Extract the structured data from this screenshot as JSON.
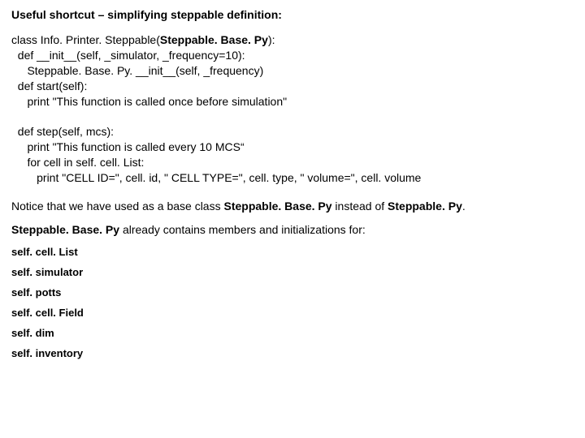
{
  "title": "Useful shortcut – simplifying steppable definition:",
  "code": {
    "l1a": "class Info. Printer. Steppable(",
    "l1b": "Steppable. Base. Py",
    "l1c": "):",
    "l2": "  def __init__(self, _simulator, _frequency=10):",
    "l3": "     Steppable. Base. Py. __init__(self, _frequency)",
    "l4": "  def start(self):",
    "l5": "     print \"This function is called once before simulation\"",
    "l6": "  def step(self, mcs):",
    "l7": "     print \"This function is called every 10 MCS“",
    "l8": "     for cell in self. cell. List:",
    "l9": "        print \"CELL ID=\", cell. id, \" CELL TYPE=\", cell. type, \" volume=\", cell. volume"
  },
  "para1": {
    "a": "Notice that we have used as a base class ",
    "b": "Steppable. Base. Py",
    "c": " instead of ",
    "d": "Steppable. Py",
    "e": "."
  },
  "para2": {
    "a": "Steppable. Base. Py",
    "b": " already contains members and initializations for:"
  },
  "members": {
    "m1": "self. cell. List",
    "m2": "self. simulator",
    "m3": "self. potts",
    "m4": "self. cell. Field",
    "m5": "self. dim",
    "m6": "self. inventory"
  }
}
